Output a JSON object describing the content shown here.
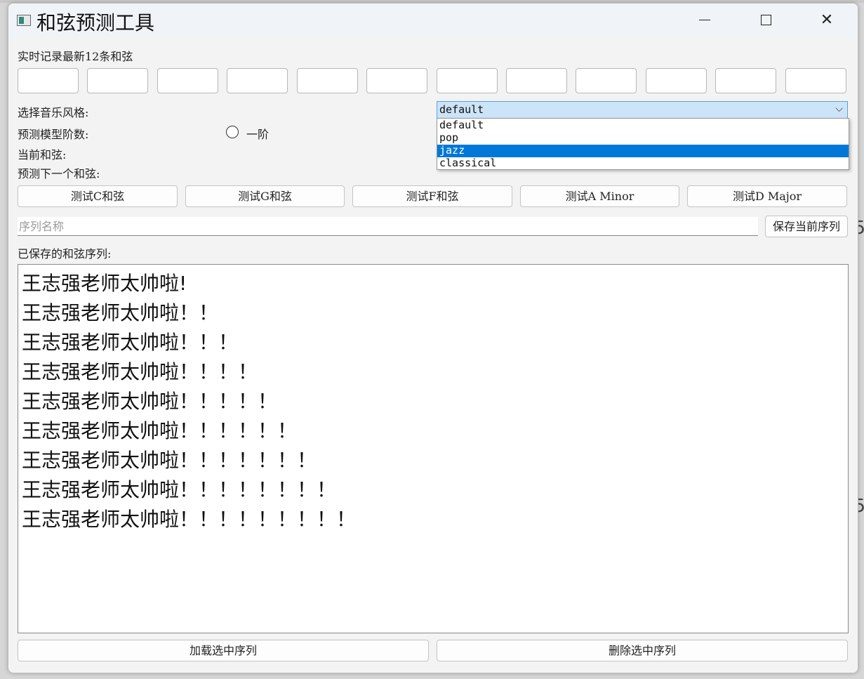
{
  "window": {
    "title": "和弦预测工具"
  },
  "controls": {
    "minimize_glyph": "—",
    "close_glyph": "✕"
  },
  "chords": {
    "label": "实时记录最新12条和弦",
    "boxes": [
      "",
      "",
      "",
      "",
      "",
      "",
      "",
      "",
      "",
      "",
      "",
      ""
    ]
  },
  "style": {
    "label": "选择音乐风格:",
    "selected": "default",
    "options": [
      "default",
      "pop",
      "jazz",
      "classical"
    ],
    "highlighted": "jazz",
    "arrow_icon": "chevron-down-icon"
  },
  "model": {
    "label": "预测模型阶数:",
    "radio_label": "一阶"
  },
  "current": {
    "label": "当前和弦:"
  },
  "next": {
    "label": "预测下一个和弦:"
  },
  "tests": {
    "c": "测试C和弦",
    "g": "测试G和弦",
    "f": "测试F和弦",
    "am": "测试A Minor",
    "dm": "测试D Major"
  },
  "sequence": {
    "placeholder": "序列名称",
    "save_label": "保存当前序列"
  },
  "saved": {
    "label": "已保存的和弦序列:",
    "items": [
      "王志强老师太帅啦!",
      "王志强老师太帅啦！！",
      "王志强老师太帅啦！！！",
      "王志强老师太帅啦！！！！",
      "王志强老师太帅啦！！！！！",
      "王志强老师太帅啦！！！！！！",
      "王志强老师太帅啦！！！！！！！",
      "王志强老师太帅啦！！！！！！！！",
      "王志强老师太帅啦！！！！！！！！！"
    ]
  },
  "footer": {
    "load_label": "加载选中序列",
    "delete_label": "删除选中序列"
  },
  "background": {
    "edge_glyph_1": "5",
    "edge_glyph_2": "5"
  }
}
